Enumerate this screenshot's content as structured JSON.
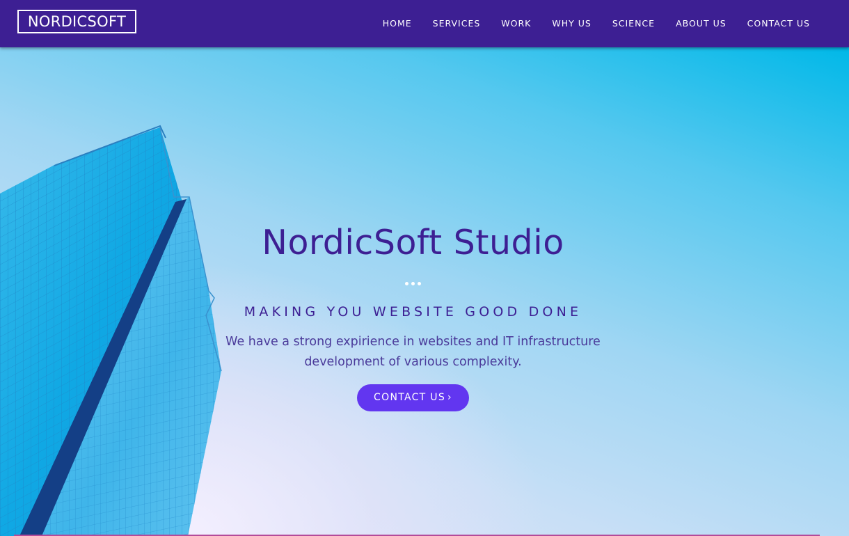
{
  "header": {
    "logo_text": "NORDICSOFT",
    "nav_items": [
      {
        "label": "HOME"
      },
      {
        "label": "SERVICES"
      },
      {
        "label": "WORK"
      },
      {
        "label": "WHY US"
      },
      {
        "label": "SCIENCE"
      },
      {
        "label": "ABOUT US"
      },
      {
        "label": "CONTACT US"
      }
    ]
  },
  "hero": {
    "title": "NordicSoft Studio",
    "subtitle": "MAKING YOU WEBSITE GOOD DONE",
    "description_line1": "We have a strong expirience in websites and IT infrastructure",
    "description_line2": "development of various complexity.",
    "cta_label": "CONTACT US",
    "cta_icon": "chevron-right-icon"
  },
  "colors": {
    "navbar_bg": "#3d1f93",
    "accent_purple": "#3d1f93",
    "cta_bg": "#6236f0",
    "sky_blue": "#00b8e8"
  }
}
